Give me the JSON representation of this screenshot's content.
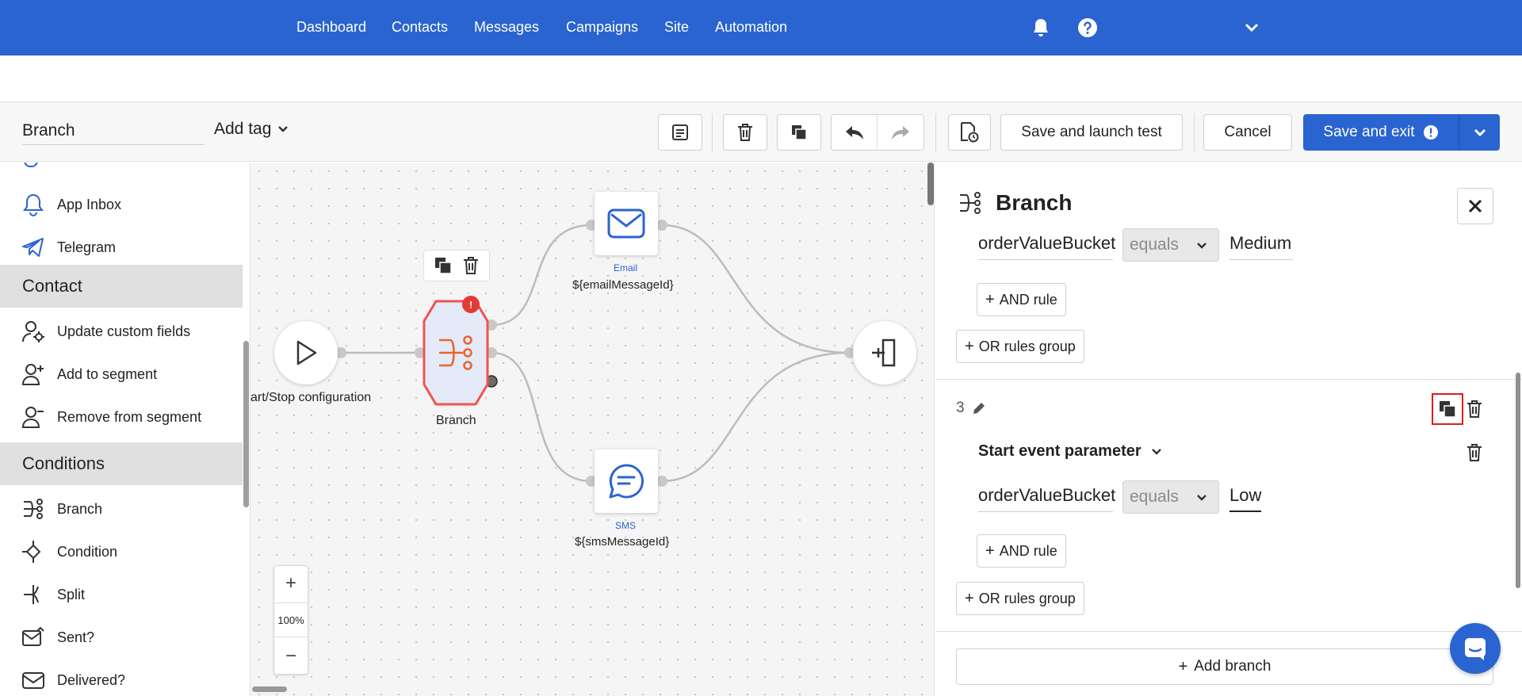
{
  "nav": {
    "items": [
      "Dashboard",
      "Contacts",
      "Messages",
      "Campaigns",
      "Site",
      "Automation"
    ],
    "icons": [
      "bell-icon",
      "help-icon",
      "chevron-down-icon"
    ]
  },
  "toolbar": {
    "name_value": "Branch",
    "add_tag_label": "Add tag",
    "save_launch_label": "Save and launch test",
    "cancel_label": "Cancel",
    "save_exit_label": "Save and exit",
    "accent_color": "#2a64d0"
  },
  "sidebar": {
    "items": [
      {
        "label": "App Inbox",
        "icon": "bell-icon"
      },
      {
        "label": "Telegram",
        "icon": "telegram-icon"
      }
    ],
    "contact_group": "Contact",
    "contact_items": [
      {
        "label": "Update custom fields",
        "icon": "user-settings-icon"
      },
      {
        "label": "Add to segment",
        "icon": "user-add-icon"
      },
      {
        "label": "Remove from segment",
        "icon": "user-remove-icon"
      }
    ],
    "conditions_group": "Conditions",
    "conditions_items": [
      {
        "label": "Branch",
        "icon": "branch-icon"
      },
      {
        "label": "Condition",
        "icon": "condition-icon"
      },
      {
        "label": "Split",
        "icon": "split-icon"
      },
      {
        "label": "Sent?",
        "icon": "sent-icon"
      },
      {
        "label": "Delivered?",
        "icon": "delivered-icon"
      }
    ]
  },
  "canvas": {
    "start_label": "art/Stop configuration",
    "branch_label": "Branch",
    "email_type": "Email",
    "email_label": "${emailMessageId}",
    "sms_type": "SMS",
    "sms_label": "${smsMessageId}",
    "error_badge": "!",
    "zoom_in": "+",
    "zoom_level": "100%",
    "zoom_out": "−"
  },
  "panel": {
    "title": "Branch",
    "branch2": {
      "param": "orderValueBucket",
      "operator": "equals",
      "value": "Medium",
      "and_rule": "AND rule",
      "or_group": "OR rules group"
    },
    "branch3": {
      "number": "3",
      "start_param": "Start event parameter",
      "param": "orderValueBucket",
      "operator": "equals",
      "value": "Low",
      "and_rule": "AND rule",
      "or_group": "OR rules group"
    },
    "add_branch": "Add branch"
  }
}
